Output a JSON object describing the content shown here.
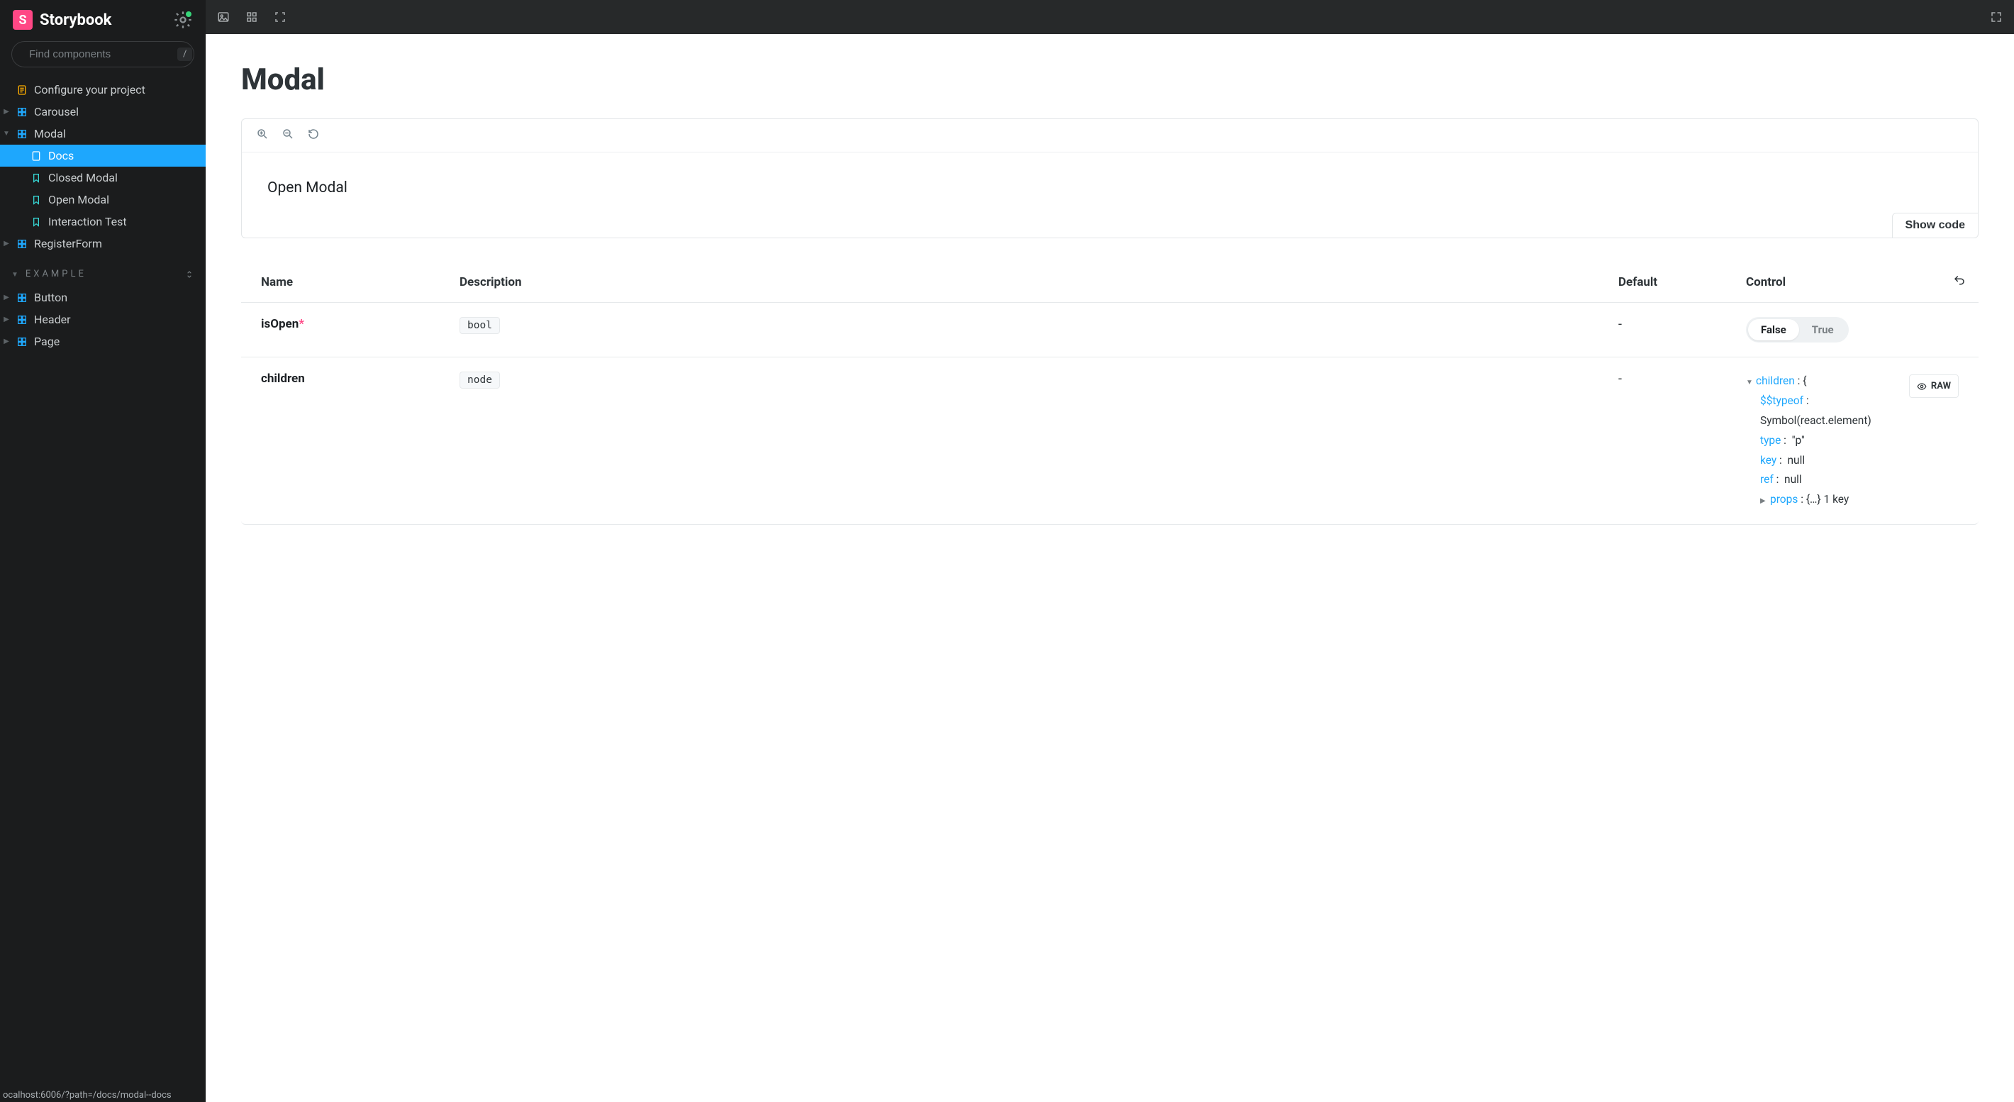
{
  "brand": {
    "title": "Storybook",
    "logo_letter": "S"
  },
  "search": {
    "placeholder": "Find components",
    "shortcut": "/"
  },
  "sidebar": {
    "top_items": [
      {
        "label": "Configure your project",
        "icon": "doc-lines",
        "depth": 0,
        "caret": "",
        "selected": false,
        "iconColor": "#ffae00"
      },
      {
        "label": "Carousel",
        "icon": "component",
        "depth": 0,
        "caret": "▶",
        "selected": false,
        "iconColor": "#1ea7fd"
      },
      {
        "label": "Modal",
        "icon": "component",
        "depth": 0,
        "caret": "▼",
        "selected": false,
        "iconColor": "#1ea7fd"
      },
      {
        "label": "Docs",
        "icon": "doc",
        "depth": 1,
        "caret": "",
        "selected": true,
        "iconColor": "#fff"
      },
      {
        "label": "Closed Modal",
        "icon": "bookmark",
        "depth": 1,
        "caret": "",
        "selected": false,
        "iconColor": "#37d5d3"
      },
      {
        "label": "Open Modal",
        "icon": "bookmark",
        "depth": 1,
        "caret": "",
        "selected": false,
        "iconColor": "#37d5d3"
      },
      {
        "label": "Interaction Test",
        "icon": "bookmark",
        "depth": 1,
        "caret": "",
        "selected": false,
        "iconColor": "#37d5d3"
      },
      {
        "label": "RegisterForm",
        "icon": "component",
        "depth": 0,
        "caret": "▶",
        "selected": false,
        "iconColor": "#1ea7fd"
      }
    ],
    "section_label": "EXAMPLE",
    "example_items": [
      {
        "label": "Button",
        "icon": "component",
        "depth": 0,
        "caret": "▶",
        "iconColor": "#1ea7fd"
      },
      {
        "label": "Header",
        "icon": "component",
        "depth": 0,
        "caret": "▶",
        "iconColor": "#1ea7fd"
      },
      {
        "label": "Page",
        "icon": "component",
        "depth": 0,
        "caret": "▶",
        "iconColor": "#1ea7fd"
      }
    ]
  },
  "status_url": "ocalhost:6006/?path=/docs/modal--docs",
  "page": {
    "title": "Modal",
    "preview_text": "Open Modal",
    "show_code_label": "Show code"
  },
  "args_table": {
    "headers": {
      "name": "Name",
      "description": "Description",
      "def": "Default",
      "control": "Control"
    },
    "rows": [
      {
        "name": "isOpen",
        "required": true,
        "type_badge": "bool",
        "def": "-",
        "control_kind": "bool",
        "bool_false": "False",
        "bool_true": "True",
        "bool_value": false
      },
      {
        "name": "children",
        "required": false,
        "type_badge": "node",
        "def": "-",
        "control_kind": "tree",
        "raw_label": "RAW",
        "tree": {
          "root_key": "children",
          "root_open": "{",
          "typeof_key": "$$typeof",
          "typeof_val": "Symbol(react.element)",
          "type_key": "type",
          "type_val": "\"p\"",
          "key_key": "key",
          "key_val": "null",
          "ref_key": "ref",
          "ref_val": "null",
          "props_key": "props",
          "props_val": "{…} 1 key"
        }
      }
    ]
  }
}
